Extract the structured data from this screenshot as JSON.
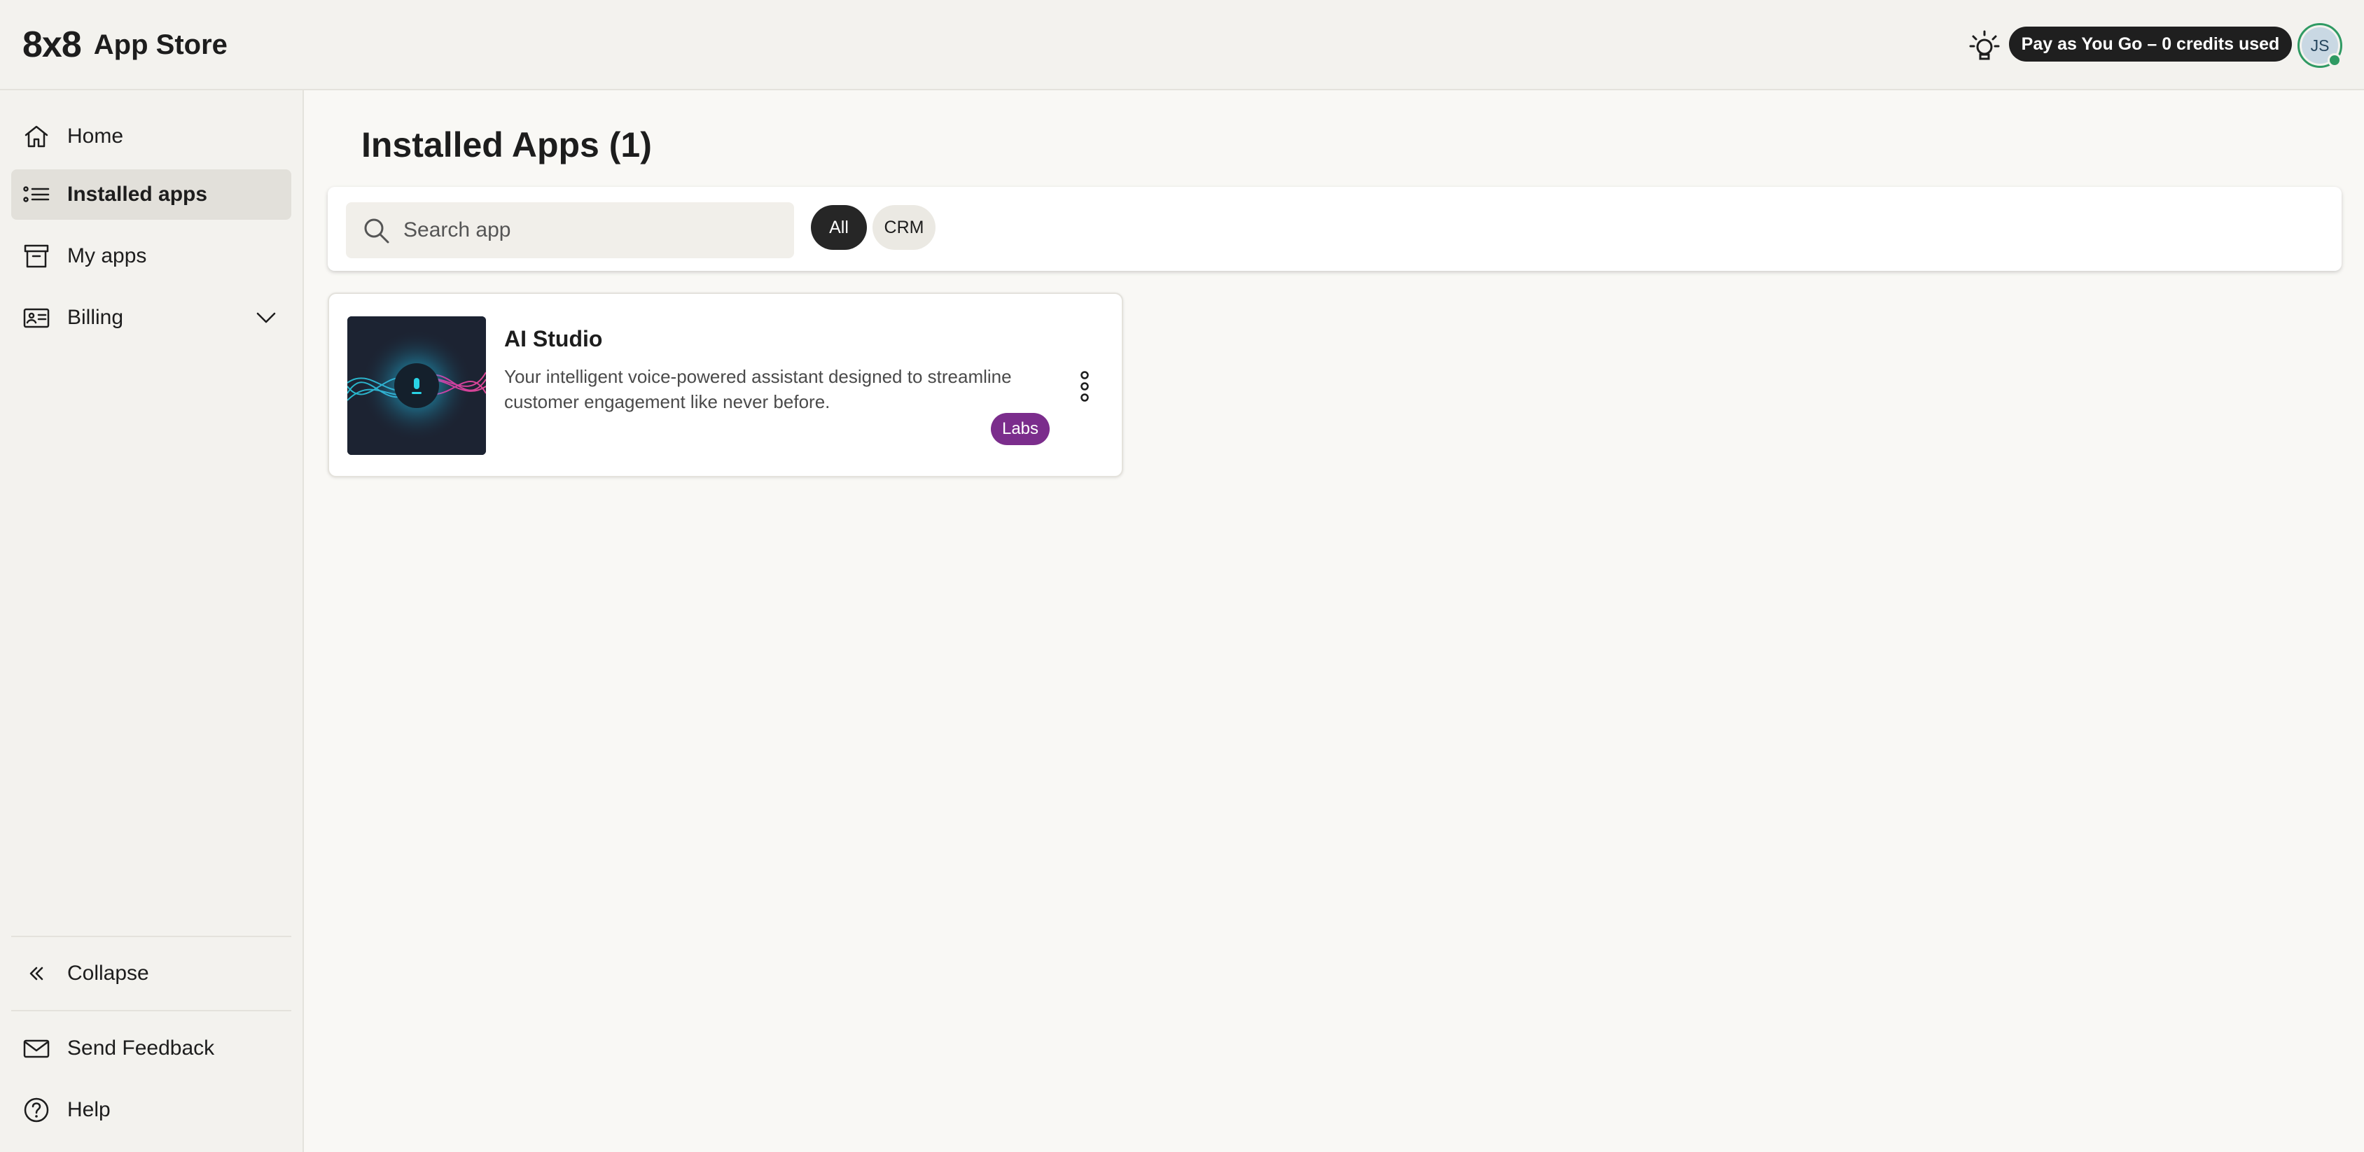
{
  "header": {
    "brand_logo": "8x8",
    "brand_title": "App Store",
    "credits_label": "Pay as You Go – 0 credits used",
    "user_initials": "JS",
    "status_color": "#2f9a63"
  },
  "sidebar": {
    "items": [
      {
        "label": "Home",
        "icon": "home-icon",
        "active": false
      },
      {
        "label": "Installed apps",
        "icon": "list-icon",
        "active": true
      },
      {
        "label": "My apps",
        "icon": "archive-box-icon",
        "active": false
      },
      {
        "label": "Billing",
        "icon": "billing-card-icon",
        "active": false,
        "expandable": true
      }
    ],
    "collapse_label": "Collapse",
    "feedback_label": "Send Feedback",
    "help_label": "Help"
  },
  "main": {
    "title": "Installed Apps (1)",
    "search": {
      "placeholder": "Search app",
      "value": ""
    },
    "filters": [
      {
        "label": "All",
        "selected": true
      },
      {
        "label": "CRM",
        "selected": false
      }
    ],
    "apps": [
      {
        "name": "AI Studio",
        "description": "Your intelligent voice-powered assistant designed to streamline customer engagement like never before.",
        "badge": "Labs",
        "badge_color": "#7b2d8c"
      }
    ]
  }
}
